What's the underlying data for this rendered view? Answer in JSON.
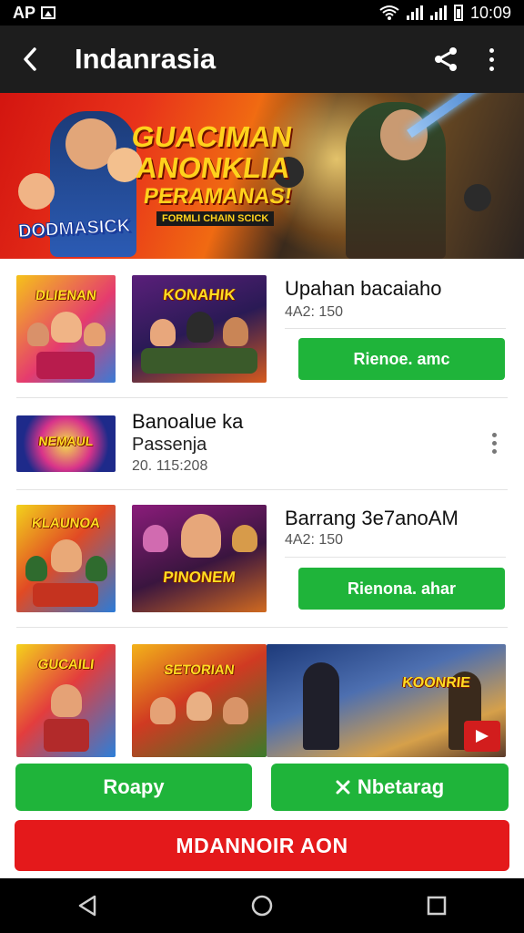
{
  "status_bar": {
    "carrier": "AP",
    "time": "10:09"
  },
  "app_bar": {
    "title": "Indanrasia"
  },
  "banner": {
    "line1": "GUACIMAN",
    "line2": "ANONKLIA",
    "line3": "PERAMANAS!",
    "tagline": "FORMLI CHAIN SCICK",
    "logo": "DODMASICK"
  },
  "list": [
    {
      "thumb1_title": "DLIENAN",
      "thumb2_title": "KONAHIK",
      "name": "Upahan bacaiaho",
      "meta": "4A2: 150",
      "button": "Rienoe. amc"
    },
    {
      "thumb1_title": "NEMAUL",
      "name": "Banoalue ka",
      "sub": "Passenja",
      "meta": "20. 115:208"
    },
    {
      "thumb1_title": "KLAUNOA",
      "thumb2_title": "PINONEM",
      "name": "Barrang 3e7anoAM",
      "meta": "4A2: 150",
      "button": "Rienona. ahar"
    },
    {
      "thumb1_title": "GUCAILI",
      "thumb2_title": "SETORIAN",
      "thumb3_title": "KOONRIE"
    }
  ],
  "actions": {
    "left_button": "Roapy",
    "right_button": "Nbetarag",
    "right_icon": "x-icon",
    "primary_button": "MDANNOIR AON"
  },
  "colors": {
    "accent_green": "#1fb43a",
    "accent_red": "#e4191b",
    "app_bar": "#1d1d1d"
  }
}
